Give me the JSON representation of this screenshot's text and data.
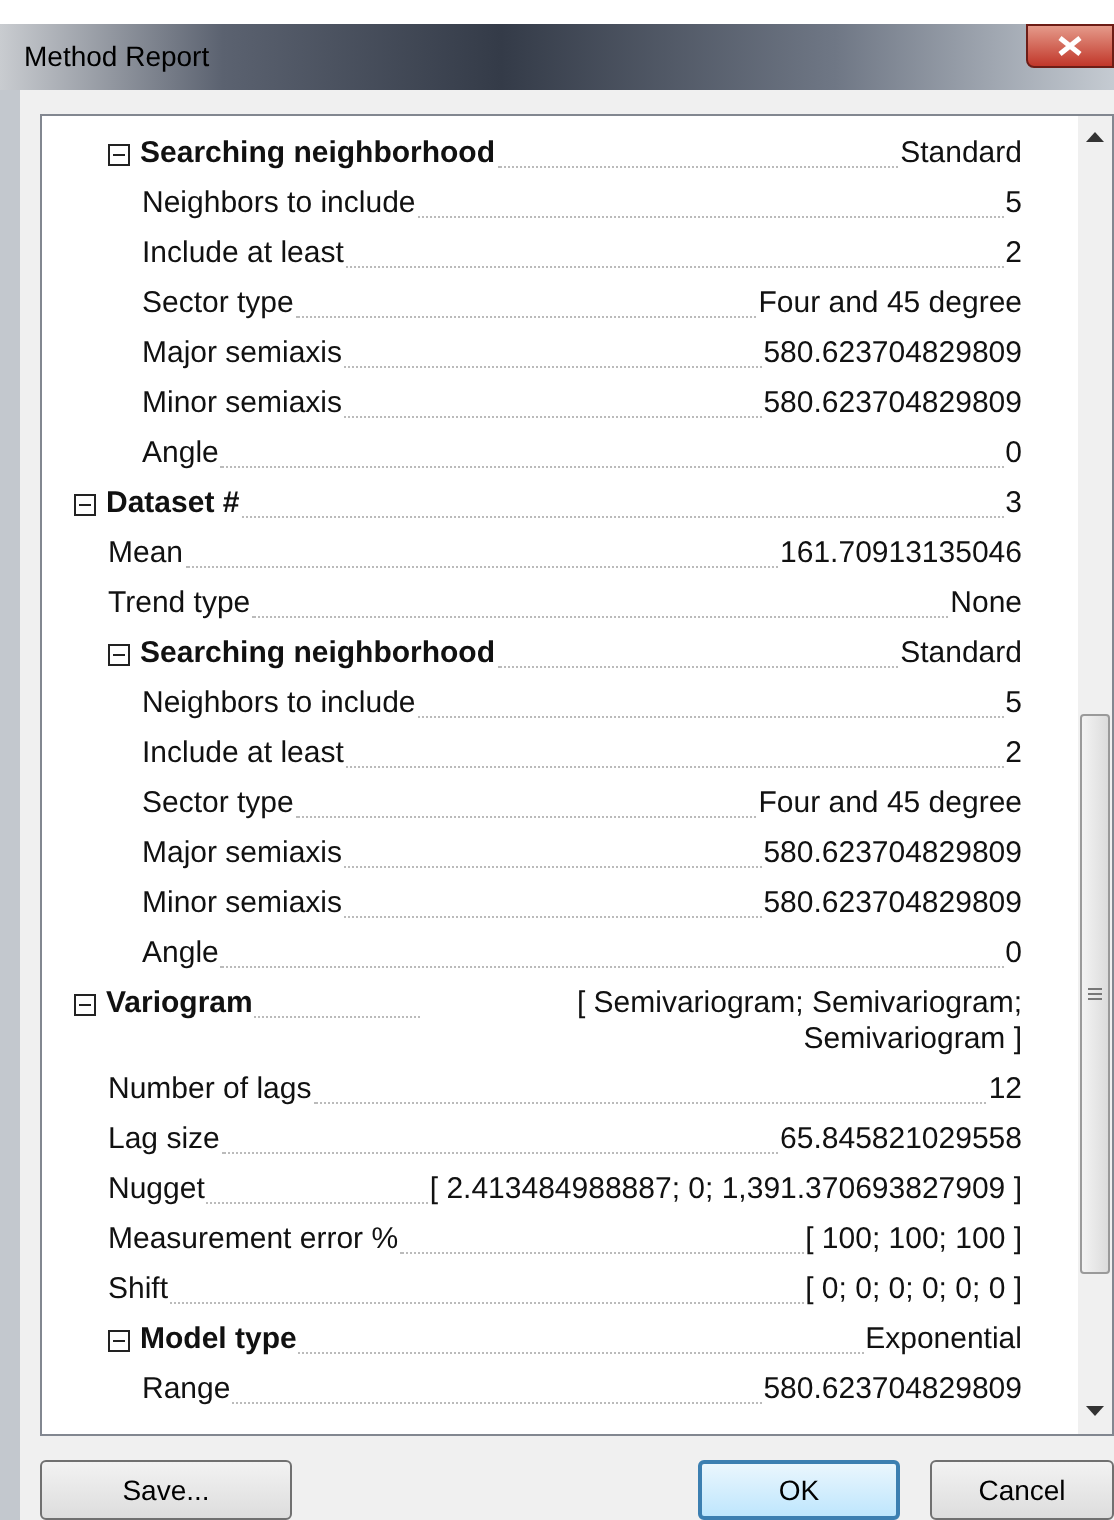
{
  "window": {
    "title": "Method Report"
  },
  "rows": [
    {
      "children": [
        {
          "label": "Searching neighborhood",
          "value": "Standard",
          "expanded": true,
          "children": [
            {
              "label": "Neighbors to include",
              "value": "5"
            },
            {
              "label": "Include at least",
              "value": "2"
            },
            {
              "label": "Sector type",
              "value": "Four and 45 degree"
            },
            {
              "label": "Major semiaxis",
              "value": "580.623704829809"
            },
            {
              "label": "Minor semiaxis",
              "value": "580.623704829809"
            },
            {
              "label": "Angle",
              "value": "0"
            }
          ]
        }
      ]
    },
    {
      "label": "Dataset #",
      "value": "3",
      "expanded": true,
      "children": [
        {
          "label": "Mean",
          "value": "161.70913135046"
        },
        {
          "label": "Trend type",
          "value": "None"
        },
        {
          "label": "Searching neighborhood",
          "value": "Standard",
          "expanded": true,
          "children": [
            {
              "label": "Neighbors to include",
              "value": "5"
            },
            {
              "label": "Include at least",
              "value": "2"
            },
            {
              "label": "Sector type",
              "value": "Four and 45 degree"
            },
            {
              "label": "Major semiaxis",
              "value": "580.623704829809"
            },
            {
              "label": "Minor semiaxis",
              "value": "580.623704829809"
            },
            {
              "label": "Angle",
              "value": "0"
            }
          ]
        }
      ]
    },
    {
      "label": "Variogram",
      "value": "[ Semivariogram; Semivariogram; Semivariogram ]",
      "expanded": true,
      "children": [
        {
          "label": "Number of lags",
          "value": "12"
        },
        {
          "label": "Lag size",
          "value": "65.845821029558"
        },
        {
          "label": "Nugget",
          "value": "[ 2.413484988887; 0; 1,391.370693827909 ]"
        },
        {
          "label": "Measurement error %",
          "value": "[ 100; 100; 100 ]"
        },
        {
          "label": "Shift",
          "value": "[ 0; 0; 0; 0; 0; 0 ]"
        },
        {
          "label": "Model type",
          "value": "Exponential",
          "expanded": true,
          "children": [
            {
              "label": "Range",
              "value": "580.623704829809"
            }
          ]
        }
      ]
    }
  ],
  "buttons": [
    {
      "label": "Save...",
      "selected": false
    },
    {
      "label": "OK",
      "selected": true
    },
    {
      "label": "Cancel",
      "selected": false
    }
  ]
}
